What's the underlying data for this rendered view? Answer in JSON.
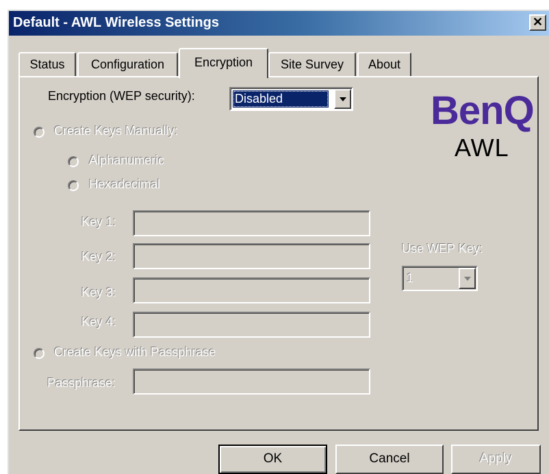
{
  "window": {
    "title": "Default - AWL Wireless Settings",
    "close_glyph": "✕"
  },
  "tabs": [
    {
      "label": "Status",
      "active": false
    },
    {
      "label": "Configuration",
      "active": false
    },
    {
      "label": "Encryption",
      "active": true
    },
    {
      "label": "Site Survey",
      "active": false
    },
    {
      "label": "About",
      "active": false
    }
  ],
  "encryption": {
    "label": "Encryption (WEP security):",
    "value": "Disabled"
  },
  "branding": {
    "logo": "BenQ",
    "product": "AWL",
    "logo_color": "#4b2a9a"
  },
  "manual_keys": {
    "label": "Create Keys Manually:",
    "alphanumeric": "Alphanumeric",
    "hexadecimal": "Hexadecimal",
    "keys": [
      {
        "label": "Key 1:",
        "value": ""
      },
      {
        "label": "Key 2:",
        "value": ""
      },
      {
        "label": "Key 3:",
        "value": ""
      },
      {
        "label": "Key 4:",
        "value": ""
      }
    ]
  },
  "use_wep_key": {
    "label": "Use WEP Key:",
    "value": "1"
  },
  "passphrase": {
    "radio_label": "Create Keys with Passphrase",
    "field_label": "Passphrase:",
    "value": ""
  },
  "buttons": {
    "ok": "OK",
    "cancel": "Cancel",
    "apply": "Apply"
  },
  "colors": {
    "titlebar_start": "#0a246a",
    "titlebar_end": "#a6caf0",
    "face": "#d4d0c8",
    "selection": "#0a246a"
  }
}
